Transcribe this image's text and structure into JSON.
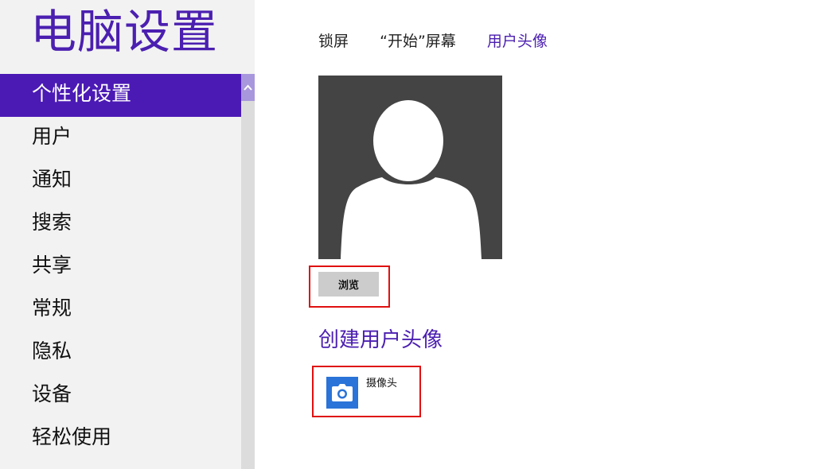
{
  "sidebar": {
    "title": "电脑设置",
    "items": [
      {
        "label": "个性化设置",
        "selected": true
      },
      {
        "label": "用户",
        "selected": false
      },
      {
        "label": "通知",
        "selected": false
      },
      {
        "label": "搜索",
        "selected": false
      },
      {
        "label": "共享",
        "selected": false
      },
      {
        "label": "常规",
        "selected": false
      },
      {
        "label": "隐私",
        "selected": false
      },
      {
        "label": "设备",
        "selected": false
      },
      {
        "label": "轻松使用",
        "selected": false
      }
    ]
  },
  "tabs": [
    {
      "label": "锁屏",
      "active": false
    },
    {
      "label": "“开始”屏幕",
      "active": false
    },
    {
      "label": "用户头像",
      "active": true
    }
  ],
  "main": {
    "avatar_icon": "default-user-silhouette-icon",
    "browse_label": "浏览",
    "create_title": "创建用户头像",
    "apps": [
      {
        "label": "摄像头",
        "icon": "camera-icon"
      }
    ]
  },
  "colors": {
    "accent": "#4b1ab5",
    "sidebar_bg": "#f2f2f2",
    "avatar_bg": "#444444",
    "highlight": "#e01010",
    "camera_tile": "#2a73d8"
  }
}
